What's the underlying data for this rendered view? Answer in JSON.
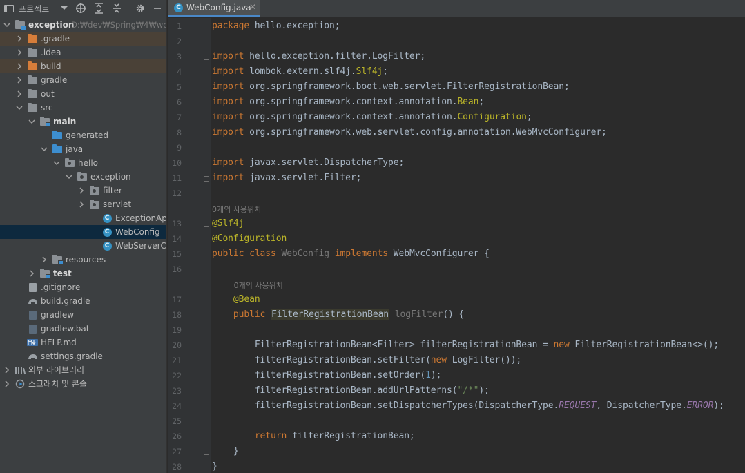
{
  "project_panel": {
    "title": "프로젝트",
    "tree": [
      {
        "label": "exception",
        "hint": "D:₩dev₩Spring₩4₩worksp",
        "bold": true,
        "depth": 0,
        "chevron": "down",
        "icon": "module-folder-icon"
      },
      {
        "label": ".gradle",
        "depth": 1,
        "chevron": "right",
        "icon": "excluded-folder-icon",
        "excluded": true
      },
      {
        "label": ".idea",
        "depth": 1,
        "chevron": "right",
        "icon": "folder-icon"
      },
      {
        "label": "build",
        "depth": 1,
        "chevron": "right",
        "icon": "excluded-folder-icon",
        "excluded": true
      },
      {
        "label": "gradle",
        "depth": 1,
        "chevron": "right",
        "icon": "folder-icon"
      },
      {
        "label": "out",
        "depth": 1,
        "chevron": "right",
        "icon": "folder-icon"
      },
      {
        "label": "src",
        "depth": 1,
        "chevron": "down",
        "icon": "folder-icon"
      },
      {
        "label": "main",
        "bold": true,
        "depth": 2,
        "chevron": "down",
        "icon": "module-folder-icon"
      },
      {
        "label": "generated",
        "depth": 3,
        "chevron": "",
        "icon": "generated-folder-icon"
      },
      {
        "label": "java",
        "depth": 3,
        "chevron": "down",
        "icon": "source-folder-icon"
      },
      {
        "label": "hello",
        "depth": 4,
        "chevron": "down",
        "icon": "package-icon"
      },
      {
        "label": "exception",
        "depth": 5,
        "chevron": "down",
        "icon": "package-icon"
      },
      {
        "label": "filter",
        "depth": 6,
        "chevron": "right",
        "icon": "package-icon"
      },
      {
        "label": "servlet",
        "depth": 6,
        "chevron": "right",
        "icon": "package-icon"
      },
      {
        "label": "ExceptionApplicat",
        "depth": 7,
        "chevron": "",
        "icon": "class-icon"
      },
      {
        "label": "WebConfig",
        "depth": 7,
        "chevron": "",
        "icon": "class-icon",
        "selected": true
      },
      {
        "label": "WebServerCustom",
        "depth": 7,
        "chevron": "",
        "icon": "class-icon"
      },
      {
        "label": "resources",
        "depth": 3,
        "chevron": "right",
        "icon": "resources-folder-icon"
      },
      {
        "label": "test",
        "bold": true,
        "depth": 2,
        "chevron": "right",
        "icon": "module-folder-icon"
      },
      {
        "label": ".gitignore",
        "depth": 1,
        "chevron": "",
        "icon": "gitignore-file-icon"
      },
      {
        "label": "build.gradle",
        "depth": 1,
        "chevron": "",
        "icon": "gradle-file-icon"
      },
      {
        "label": "gradlew",
        "depth": 1,
        "chevron": "",
        "icon": "shell-file-icon"
      },
      {
        "label": "gradlew.bat",
        "depth": 1,
        "chevron": "",
        "icon": "bat-file-icon"
      },
      {
        "label": "HELP.md",
        "depth": 1,
        "chevron": "",
        "icon": "markdown-file-icon"
      },
      {
        "label": "settings.gradle",
        "depth": 1,
        "chevron": "",
        "icon": "gradle-file-icon"
      },
      {
        "label": "외부 라이브러리",
        "depth": 0,
        "chevron": "right",
        "icon": "libraries-icon"
      },
      {
        "label": "스크래치 및 콘솔",
        "depth": 0,
        "chevron": "right",
        "icon": "scratches-icon"
      }
    ]
  },
  "editor": {
    "tab": {
      "label": "WebConfig.java",
      "icon": "class-icon"
    },
    "usage_hint": "0개의 사용위치",
    "lines": [
      {
        "n": "1",
        "html": "<span class=\"kw\">package</span> hello.exception;"
      },
      {
        "n": "2",
        "html": ""
      },
      {
        "n": "3",
        "html": "<span class=\"kw\">import</span> hello.exception.filter.LogFilter;",
        "fold": true
      },
      {
        "n": "4",
        "html": "<span class=\"kw\">import</span> lombok.extern.slf4j.<span class=\"an\">Slf4j</span>;"
      },
      {
        "n": "5",
        "html": "<span class=\"kw\">import</span> org.springframework.boot.web.servlet.FilterRegistrationBean;"
      },
      {
        "n": "6",
        "html": "<span class=\"kw\">import</span> org.springframework.context.annotation.<span class=\"an\">Bean</span>;"
      },
      {
        "n": "7",
        "html": "<span class=\"kw\">import</span> org.springframework.context.annotation.<span class=\"an\">Configuration</span>;"
      },
      {
        "n": "8",
        "html": "<span class=\"kw\">import</span> org.springframework.web.servlet.config.annotation.WebMvcConfigurer;"
      },
      {
        "n": "9",
        "html": ""
      },
      {
        "n": "10",
        "html": "<span class=\"kw\">import</span> javax.servlet.DispatcherType;"
      },
      {
        "n": "11",
        "html": "<span class=\"kw\">import</span> javax.servlet.Filter;",
        "fold": true
      },
      {
        "n": "12",
        "html": ""
      },
      {
        "n": "13",
        "html": "<span class=\"an\">@Slf4j</span>",
        "fold": true,
        "hint_above": true,
        "hint_indent": 0
      },
      {
        "n": "14",
        "html": "<span class=\"an\">@Configuration</span>"
      },
      {
        "n": "15",
        "html": "<span class=\"kw\">public class</span> <span class=\"gray\">WebConfig</span> <span class=\"kw\">implements</span> WebMvcConfigurer {"
      },
      {
        "n": "16",
        "html": ""
      },
      {
        "n": "17",
        "html": "    <span class=\"an\">@Bean</span>",
        "hint_above": true,
        "hint_indent": 4
      },
      {
        "n": "18",
        "html": "    <span class=\"kw\">public</span> <span class=\"hl\">FilterRegistrationBean</span> <span class=\"gray\">logFilter</span>() {",
        "fold": true
      },
      {
        "n": "19",
        "html": ""
      },
      {
        "n": "20",
        "html": "        FilterRegistrationBean&lt;Filter&gt; filterRegistrationBean = <span class=\"kw\">new</span> FilterRegistrationBean&lt;&gt;();"
      },
      {
        "n": "21",
        "html": "        filterRegistrationBean.setFilter(<span class=\"kw\">new</span> LogFilter());"
      },
      {
        "n": "22",
        "html": "        filterRegistrationBean.setOrder(<span class=\"num\">1</span>);"
      },
      {
        "n": "23",
        "html": "        filterRegistrationBean.addUrlPatterns(<span class=\"str\">\"/*\"</span>);"
      },
      {
        "n": "24",
        "html": "        filterRegistrationBean.setDispatcherTypes(DispatcherType.<span class=\"cn\">REQUEST</span>, DispatcherType.<span class=\"cn\">ERROR</span>);"
      },
      {
        "n": "25",
        "html": ""
      },
      {
        "n": "26",
        "html": "        <span class=\"kw\">return</span> filterRegistrationBean;"
      },
      {
        "n": "27",
        "html": "    }",
        "fold": true
      },
      {
        "n": "28",
        "html": "}"
      }
    ]
  }
}
